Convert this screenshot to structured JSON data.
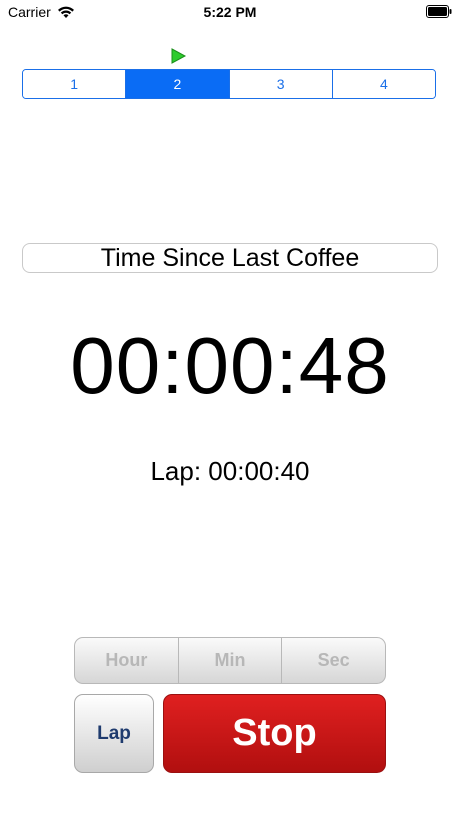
{
  "status_bar": {
    "carrier": "Carrier",
    "time": "5:22 PM"
  },
  "icons": {
    "wifi": "wifi-icon",
    "battery": "battery-icon",
    "play": "play-icon"
  },
  "colors": {
    "accent": "#0a6cf5",
    "play_indicator": "#2ecc2e",
    "stop": "#c81616"
  },
  "timer_tabs": {
    "selected": "2",
    "items": [
      {
        "label": "1"
      },
      {
        "label": "2"
      },
      {
        "label": "3"
      },
      {
        "label": "4"
      }
    ]
  },
  "timer": {
    "title": "Time Since Last Coffee",
    "elapsed": "00:00:48",
    "lap": "Lap: 00:00:40"
  },
  "units": {
    "items": [
      {
        "label": "Hour"
      },
      {
        "label": "Min"
      },
      {
        "label": "Sec"
      }
    ]
  },
  "actions": {
    "lap_label": "Lap",
    "stop_label": "Stop"
  }
}
